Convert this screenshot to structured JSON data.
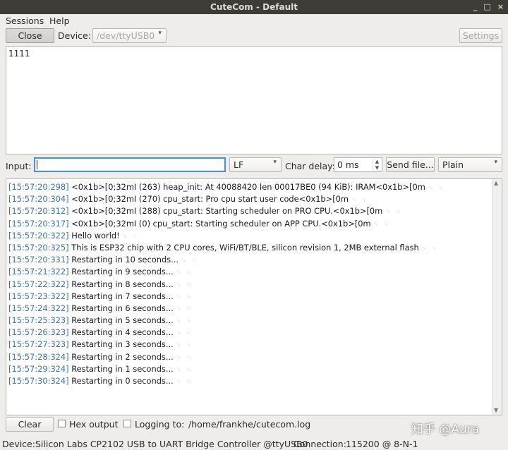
{
  "window": {
    "title": "CuteCom - Default",
    "minimize": "_",
    "restore": "□",
    "close": "×"
  },
  "menu": {
    "sessions": "Sessions",
    "help": "Help"
  },
  "toolbar": {
    "close_label": "Close",
    "device_label": "Device:",
    "device_value": "/dev/ttyUSB0",
    "settings_label": "Settings"
  },
  "input_area": {
    "text": "1111"
  },
  "input_row": {
    "label": "Input:",
    "value": "",
    "line_ending": "LF",
    "char_delay_label": "Char delay:",
    "char_delay_value": "0 ms",
    "send_file_label": "Send file...",
    "format_value": "Plain"
  },
  "output": {
    "lines": [
      {
        "ts": "[15:57:20:298]",
        "text": "<0x1b>[0;32mI (263) heap_init: At 40088420 len 00017BE0 (94 KiB): IRAM<0x1b>[0m"
      },
      {
        "ts": "[15:57:20:304]",
        "text": "<0x1b>[0;32mI (270) cpu_start: Pro cpu start user code<0x1b>[0m"
      },
      {
        "ts": "[15:57:20:312]",
        "text": "<0x1b>[0;32mI (288) cpu_start: Starting scheduler on PRO CPU.<0x1b>[0m"
      },
      {
        "ts": "[15:57:20:317]",
        "text": "<0x1b>[0;32mI (0) cpu_start: Starting scheduler on APP CPU.<0x1b>[0m"
      },
      {
        "ts": "[15:57:20:322]",
        "text": "Hello world!"
      },
      {
        "ts": "[15:57:20:325]",
        "text": "This is ESP32 chip with 2 CPU cores, WiFi/BT/BLE, silicon revision 1, 2MB external flash"
      },
      {
        "ts": "[15:57:20:331]",
        "text": "Restarting in 10 seconds..."
      },
      {
        "ts": "[15:57:21:322]",
        "text": "Restarting in 9 seconds..."
      },
      {
        "ts": "[15:57:22:322]",
        "text": "Restarting in 8 seconds..."
      },
      {
        "ts": "[15:57:23:322]",
        "text": "Restarting in 7 seconds..."
      },
      {
        "ts": "[15:57:24:322]",
        "text": "Restarting in 6 seconds..."
      },
      {
        "ts": "[15:57:25:323]",
        "text": "Restarting in 5 seconds..."
      },
      {
        "ts": "[15:57:26:323]",
        "text": "Restarting in 4 seconds..."
      },
      {
        "ts": "[15:57:27:323]",
        "text": "Restarting in 3 seconds..."
      },
      {
        "ts": "[15:57:28:324]",
        "text": "Restarting in 2 seconds..."
      },
      {
        "ts": "[15:57:29:324]",
        "text": "Restarting in 1 seconds..."
      },
      {
        "ts": "[15:57:30:324]",
        "text": "Restarting in 0 seconds..."
      }
    ],
    "line_end_marker": "␍ ␊"
  },
  "bottom": {
    "clear_label": "Clear",
    "hex_output_label": "Hex output",
    "logging_label": "Logging to:",
    "log_path": "/home/frankhe/cutecom.log"
  },
  "status": {
    "device_label": "Device:",
    "device_value": "Silicon Labs CP2102 USB to UART Bridge Controller @ttyUSB0",
    "connection_label": "Connection:",
    "connection_value": "115200 @ 8-N-1"
  },
  "watermark": "知乎 @Aura",
  "colors": {
    "titlebar": "#3d3c37",
    "timestamp": "#3e72a8",
    "focus": "#4a90d9"
  }
}
